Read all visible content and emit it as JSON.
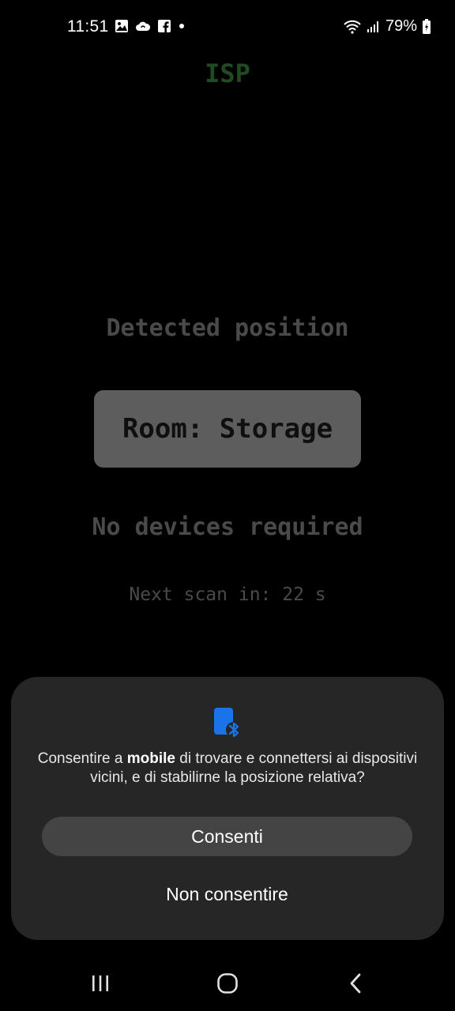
{
  "status_bar": {
    "time": "11:51",
    "battery": "79%",
    "notification_icons": [
      "image-icon",
      "cloud-icon",
      "facebook-icon",
      "dot-icon"
    ],
    "system_icons": [
      "wifi-icon",
      "signal-icon",
      "battery-icon"
    ]
  },
  "app": {
    "title": "ISP",
    "detected_label": "Detected position",
    "room": "Room: Storage",
    "devices_label": "No devices required",
    "next_scan": "Next scan in: 22 s"
  },
  "dialog": {
    "icon": "nearby-devices-bluetooth-icon",
    "message_prefix": "Consentire a ",
    "message_app": "mobile",
    "message_suffix": " di trovare e connettersi ai dispositivi vicini, e di stabilirne la posizione relativa?",
    "allow_label": "Consenti",
    "deny_label": "Non consentire"
  },
  "colors": {
    "background": "#000000",
    "title_green": "#1f4a22",
    "dim_text": "#4a4a4a",
    "room_box": "#5d5d5d",
    "dialog_bg": "#262626",
    "allow_btn": "#444444",
    "accent_blue": "#1a73e8"
  }
}
